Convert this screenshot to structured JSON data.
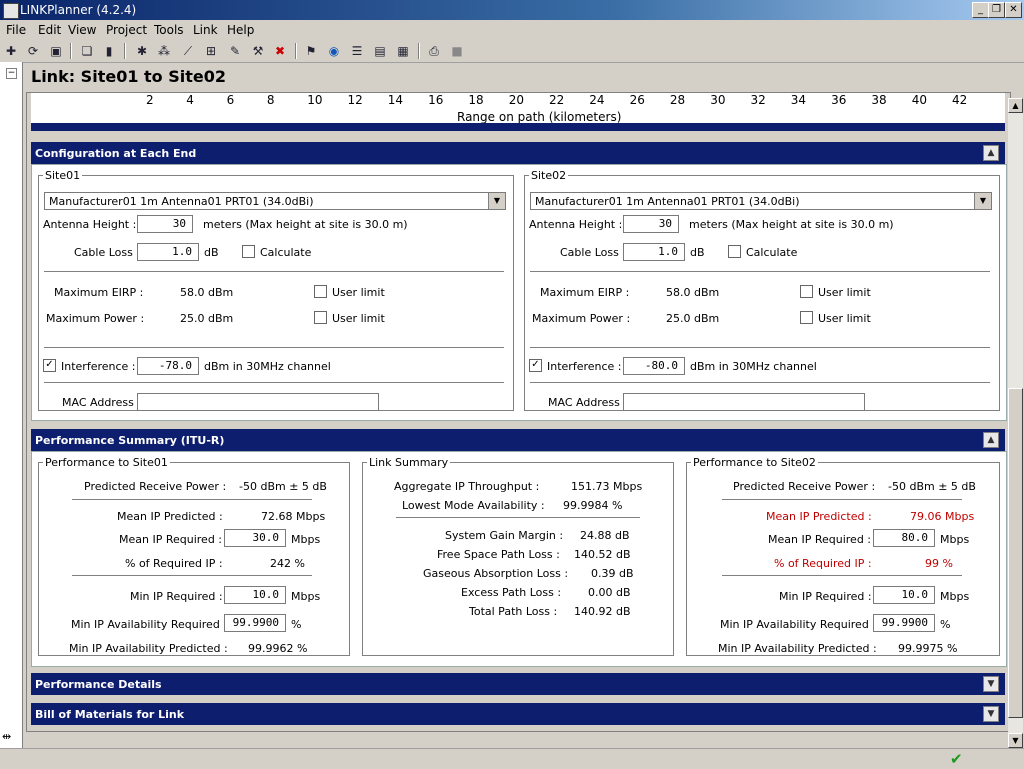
{
  "window": {
    "title": "LINKPlanner (4.2.4)"
  },
  "menu": [
    "File",
    "Edit",
    "View",
    "Project",
    "Tools",
    "Link",
    "Help"
  ],
  "page": {
    "heading": "Link: Site01 to Site02"
  },
  "range_axis": {
    "ticks": [
      "2",
      "4",
      "6",
      "8",
      "10",
      "12",
      "14",
      "16",
      "18",
      "20",
      "22",
      "24",
      "26",
      "28",
      "30",
      "32",
      "34",
      "36",
      "38",
      "40",
      "42"
    ],
    "label": "Range on path (kilometers)"
  },
  "config": {
    "header": "Configuration at Each End",
    "site01": {
      "title": "Site01",
      "antenna": "Manufacturer01 1m Antenna01 PRT01 (34.0dBi)",
      "antenna_height_label": "Antenna Height :",
      "antenna_height": "30",
      "antenna_height_unit": "meters  (Max height at site is 30.0 m)",
      "cable_loss_label": "Cable Loss :",
      "cable_loss": "1.0",
      "cable_loss_unit": "dB",
      "calculate_label": "Calculate",
      "max_eirp_label": "Maximum EIRP :",
      "max_eirp": "58.0 dBm",
      "max_power_label": "Maximum Power :",
      "max_power": "25.0 dBm",
      "user_limit_label": "User limit",
      "interference_label": "Interference :",
      "interference": "-78.0",
      "interference_unit": "dBm in 30MHz channel",
      "mac_label": "MAC Address :",
      "mac": ""
    },
    "site02": {
      "title": "Site02",
      "antenna": "Manufacturer01 1m Antenna01 PRT01 (34.0dBi)",
      "antenna_height_label": "Antenna Height :",
      "antenna_height": "30",
      "antenna_height_unit": "meters  (Max height at site is 30.0 m)",
      "cable_loss_label": "Cable Loss :",
      "cable_loss": "1.0",
      "cable_loss_unit": "dB",
      "calculate_label": "Calculate",
      "max_eirp_label": "Maximum EIRP :",
      "max_eirp": "58.0 dBm",
      "max_power_label": "Maximum Power :",
      "max_power": "25.0 dBm",
      "user_limit_label": "User limit",
      "interference_label": "Interference :",
      "interference": "-80.0",
      "interference_unit": "dBm in 30MHz channel",
      "mac_label": "MAC Address :",
      "mac": ""
    }
  },
  "performance": {
    "header": "Performance Summary (ITU-R)",
    "to_site01": {
      "title": "Performance to Site01",
      "prx_label": "Predicted Receive Power :",
      "prx": "-50 dBm ± 5 dB",
      "mean_pred_label": "Mean IP Predicted :",
      "mean_pred": "72.68 Mbps",
      "mean_req_label": "Mean IP Required :",
      "mean_req": "30.0",
      "mean_req_unit": "Mbps",
      "pct_label": "% of Required IP :",
      "pct": "242 %",
      "min_req_label": "Min IP Required :",
      "min_req": "10.0",
      "min_req_unit": "Mbps",
      "min_avail_req_label": "Min IP Availability Required :",
      "min_avail_req": "99.9900",
      "min_avail_req_unit": "%",
      "min_avail_pred_label": "Min IP Availability Predicted :",
      "min_avail_pred": "99.9962 %"
    },
    "link_summary": {
      "title": "Link Summary",
      "agg_label": "Aggregate IP Throughput :",
      "agg": "151.73 Mbps",
      "lowest_label": "Lowest Mode Availability :",
      "lowest": "99.9984 %",
      "sgm_label": "System Gain Margin :",
      "sgm": "24.88 dB",
      "fspl_label": "Free Space Path Loss :",
      "fspl": "140.52 dB",
      "gas_label": "Gaseous Absorption Loss :",
      "gas": "0.39 dB",
      "excess_label": "Excess Path Loss :",
      "excess": "0.00 dB",
      "total_label": "Total Path Loss :",
      "total": "140.92 dB"
    },
    "to_site02": {
      "title": "Performance to Site02",
      "prx_label": "Predicted Receive Power :",
      "prx": "-50 dBm ± 5 dB",
      "mean_pred_label": "Mean IP Predicted :",
      "mean_pred": "79.06 Mbps",
      "mean_req_label": "Mean IP Required :",
      "mean_req": "80.0",
      "mean_req_unit": "Mbps",
      "pct_label": "% of Required IP :",
      "pct": "99 %",
      "min_req_label": "Min IP Required :",
      "min_req": "10.0",
      "min_req_unit": "Mbps",
      "min_avail_req_label": "Min IP Availability Required :",
      "min_avail_req": "99.9900",
      "min_avail_req_unit": "%",
      "min_avail_pred_label": "Min IP Availability Predicted :",
      "min_avail_pred": "99.9975 %"
    }
  },
  "sections": {
    "details": "Performance Details",
    "bom": "Bill of Materials for Link"
  },
  "colors": {
    "header_bg": "#0e1e6e",
    "warning": "#c00000",
    "ok": "#1a9a1a"
  }
}
